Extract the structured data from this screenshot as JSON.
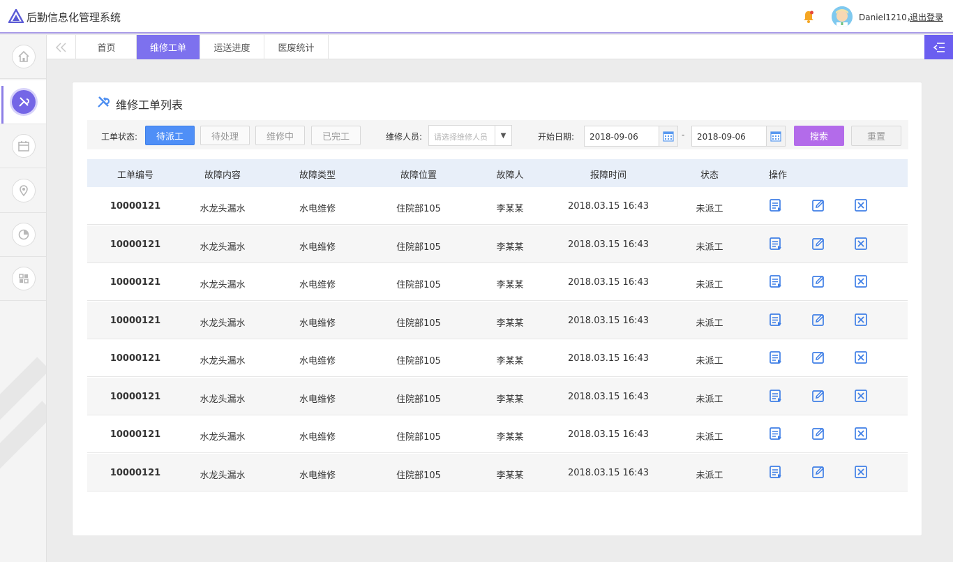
{
  "header": {
    "app_title": "后勤信息化管理系统",
    "user_name": "Daniel1210，",
    "logout": "退出登录"
  },
  "rail": {
    "items": [
      {
        "icon": "home-icon"
      },
      {
        "icon": "wrench-icon",
        "active": true
      },
      {
        "icon": "calendar-icon"
      },
      {
        "icon": "location-icon"
      },
      {
        "icon": "pie-chart-icon"
      },
      {
        "icon": "puzzle-icon"
      }
    ]
  },
  "tabs": {
    "back": "《",
    "items": [
      {
        "label": "首页"
      },
      {
        "label": "维修工单"
      },
      {
        "label": "运送进度"
      },
      {
        "label": "医废统计"
      }
    ]
  },
  "card": {
    "title": "维修工单列表"
  },
  "filter": {
    "status_label": "工单状态:",
    "status_buttons": [
      "待派工",
      "待处理",
      "维修中",
      "已完工"
    ],
    "repair_label": "维修人员:",
    "repair_placeholder": "请选择维修人员",
    "date_label": "开始日期:",
    "date_from": "2018-09-06",
    "date_sep": "-",
    "date_to": "2018-09-06",
    "search": "搜索",
    "reset": "重置"
  },
  "table": {
    "headers": [
      "工单编号",
      "故障内容",
      "故障类型",
      "故障位置",
      "故障人",
      "报障时间",
      "状态",
      "操作"
    ],
    "rows": [
      [
        "10000121",
        "水龙头漏水",
        "水电维修",
        "住院部105",
        "李某某",
        "2018.03.15 16:43",
        "未派工"
      ],
      [
        "10000121",
        "水龙头漏水",
        "水电维修",
        "住院部105",
        "李某某",
        "2018.03.15 16:43",
        "未派工"
      ],
      [
        "10000121",
        "水龙头漏水",
        "水电维修",
        "住院部105",
        "李某某",
        "2018.03.15 16:43",
        "未派工"
      ],
      [
        "10000121",
        "水龙头漏水",
        "水电维修",
        "住院部105",
        "李某某",
        "2018.03.15 16:43",
        "未派工"
      ],
      [
        "10000121",
        "水龙头漏水",
        "水电维修",
        "住院部105",
        "李某某",
        "2018.03.15 16:43",
        "未派工"
      ],
      [
        "10000121",
        "水龙头漏水",
        "水电维修",
        "住院部105",
        "李某某",
        "2018.03.15 16:43",
        "未派工"
      ],
      [
        "10000121",
        "水龙头漏水",
        "水电维修",
        "住院部105",
        "李某某",
        "2018.03.15 16:43",
        "未派工"
      ],
      [
        "10000121",
        "水龙头漏水",
        "水电维修",
        "住院部105",
        "李某某",
        "2018.03.15 16:43",
        "未派工"
      ]
    ]
  },
  "colors": {
    "accent": "#7d71ee",
    "active_status": "#4f8ff7",
    "search_button": "#b36bea",
    "icon_blue": "#3f7fe6"
  }
}
